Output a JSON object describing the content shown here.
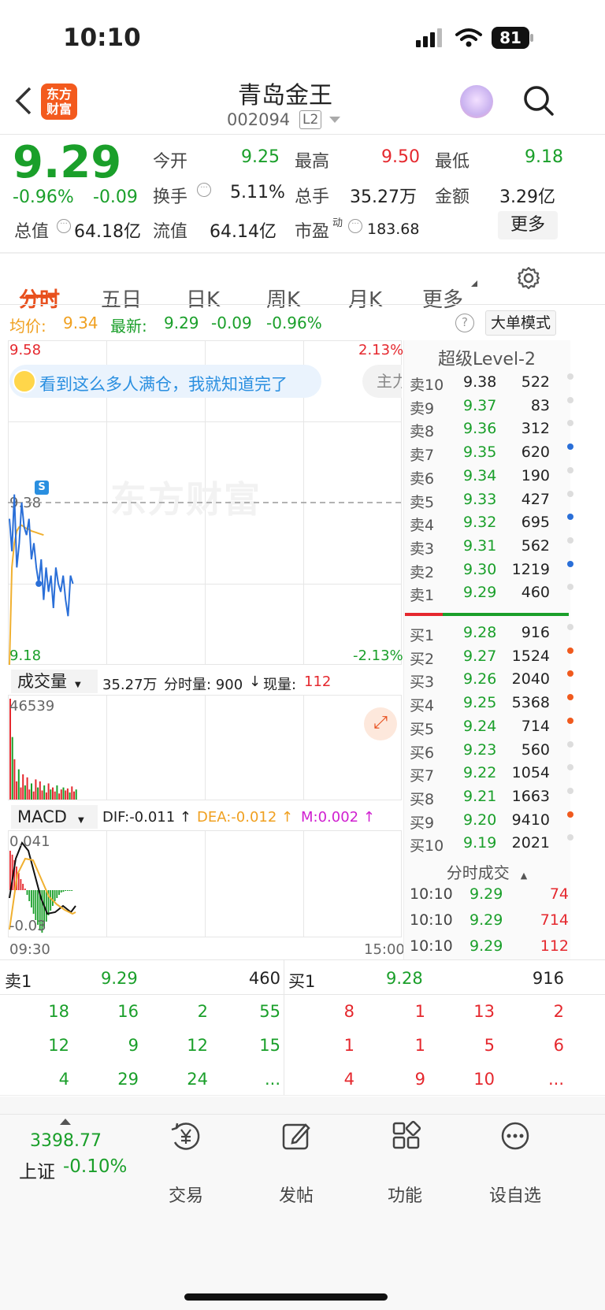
{
  "status": {
    "time": "10:10",
    "battery": "81"
  },
  "header": {
    "title": "青岛金王",
    "code": "002094",
    "level_badge": "L2",
    "brand_line1": "东方",
    "brand_line2": "财富"
  },
  "quote": {
    "price": "9.29",
    "change_pct": "-0.96%",
    "change": "-0.09",
    "labels": {
      "open": "今开",
      "high": "最高",
      "low": "最低",
      "turnover": "换手",
      "volume": "总手",
      "amount": "金额",
      "mcap": "总值",
      "float_mcap": "流值",
      "pe": "市盈",
      "pe_sup": "动"
    },
    "open": "9.25",
    "high": "9.50",
    "low": "9.18",
    "turnover": "5.11%",
    "volume": "35.27万",
    "amount": "3.29亿",
    "mcap": "64.18亿",
    "float_mcap": "64.14亿",
    "pe": "183.68",
    "more": "更多"
  },
  "tabs": [
    "分时",
    "五日",
    "日K",
    "周K",
    "月K",
    "更多"
  ],
  "info": {
    "avg_label": "均价:",
    "avg": "9.34",
    "latest_label": "最新:",
    "latest": "9.29",
    "chg": "-0.09",
    "chg_pct": "-0.96%",
    "big_order": "大单模式"
  },
  "chart": {
    "y_top": "9.58",
    "y_bottom": "9.18",
    "pct_top": "2.13%",
    "pct_bottom": "-2.13%",
    "y_mid": "9.38",
    "banner": "看到这么多人满仓，我就知道完了",
    "banner_right": "主力",
    "watermark": "东方财富",
    "s_badge": "S",
    "vol_label": "成交量",
    "vol_total": "35.27万",
    "vol_period": "分时量: 900",
    "vol_arrow": "↓",
    "vol_now_label": "现量:",
    "vol_now": "112",
    "vol_max": "46539",
    "macd_label": "MACD",
    "dif": "DIF:-0.011 ↑",
    "dea": "DEA:-0.012 ↑",
    "m": "M:0.002 ↑",
    "macd_top": "0.041",
    "macd_bottom": "-0.03",
    "t_start": "09:30",
    "t_end": "15:00"
  },
  "chart_data": {
    "type": "line",
    "x_range": [
      "09:30",
      "15:00"
    ],
    "ylim": [
      9.18,
      9.58
    ],
    "reference_price": 9.38,
    "series": [
      {
        "values": [
          9.36,
          9.32,
          9.39,
          9.3,
          9.33,
          9.38,
          9.35,
          9.34,
          9.36,
          9.31,
          9.33,
          9.3,
          9.28,
          9.31,
          9.26,
          9.3,
          9.27,
          9.29,
          9.25,
          9.3,
          9.28,
          9.27,
          9.29,
          9.26,
          9.24,
          9.29,
          9.28
        ]
      },
      {
        "values": [
          9.18,
          9.3,
          9.33,
          9.345,
          9.35,
          9.352,
          9.35,
          9.348,
          9.347,
          9.345,
          9.344,
          9.343,
          9.342,
          9.341,
          9.34
        ]
      }
    ]
  },
  "orderbook": {
    "title": "超级Level-2",
    "asks": [
      {
        "label": "卖10",
        "price": "9.38",
        "vol": "522"
      },
      {
        "label": "卖9",
        "price": "9.37",
        "vol": "83"
      },
      {
        "label": "卖8",
        "price": "9.36",
        "vol": "312"
      },
      {
        "label": "卖7",
        "price": "9.35",
        "vol": "620"
      },
      {
        "label": "卖6",
        "price": "9.34",
        "vol": "190"
      },
      {
        "label": "卖5",
        "price": "9.33",
        "vol": "427"
      },
      {
        "label": "卖4",
        "price": "9.32",
        "vol": "695"
      },
      {
        "label": "卖3",
        "price": "9.31",
        "vol": "562"
      },
      {
        "label": "卖2",
        "price": "9.30",
        "vol": "1219"
      },
      {
        "label": "卖1",
        "price": "9.29",
        "vol": "460"
      }
    ],
    "bids": [
      {
        "label": "买1",
        "price": "9.28",
        "vol": "916"
      },
      {
        "label": "买2",
        "price": "9.27",
        "vol": "1524"
      },
      {
        "label": "买3",
        "price": "9.26",
        "vol": "2040"
      },
      {
        "label": "买4",
        "price": "9.25",
        "vol": "5368"
      },
      {
        "label": "买5",
        "price": "9.24",
        "vol": "714"
      },
      {
        "label": "买6",
        "price": "9.23",
        "vol": "560"
      },
      {
        "label": "买7",
        "price": "9.22",
        "vol": "1054"
      },
      {
        "label": "买8",
        "price": "9.21",
        "vol": "1663"
      },
      {
        "label": "买9",
        "price": "9.20",
        "vol": "9410"
      },
      {
        "label": "买10",
        "price": "9.19",
        "vol": "2021"
      }
    ],
    "ticks_title": "分时成交",
    "ticks": [
      {
        "t": "10:10",
        "p": "9.29",
        "v": "74"
      },
      {
        "t": "10:10",
        "p": "9.29",
        "v": "714"
      },
      {
        "t": "10:10",
        "p": "9.29",
        "v": "112"
      }
    ]
  },
  "queue": {
    "sell_label": "卖1",
    "sell_price": "9.29",
    "sell_vol": "460",
    "buy_label": "买1",
    "buy_price": "9.28",
    "buy_vol": "916",
    "sell_cells": [
      "18",
      "16",
      "2",
      "55",
      "12",
      "9",
      "12",
      "15",
      "4",
      "29",
      "24",
      "..."
    ],
    "buy_cells": [
      "8",
      "1",
      "13",
      "2",
      "1",
      "1",
      "5",
      "6",
      "4",
      "9",
      "10",
      "..."
    ]
  },
  "bottom": {
    "index_value": "3398.77",
    "index_name": "上证",
    "index_pct": "-0.10%",
    "trade": "交易",
    "post": "发帖",
    "func": "功能",
    "watch": "设自选"
  }
}
